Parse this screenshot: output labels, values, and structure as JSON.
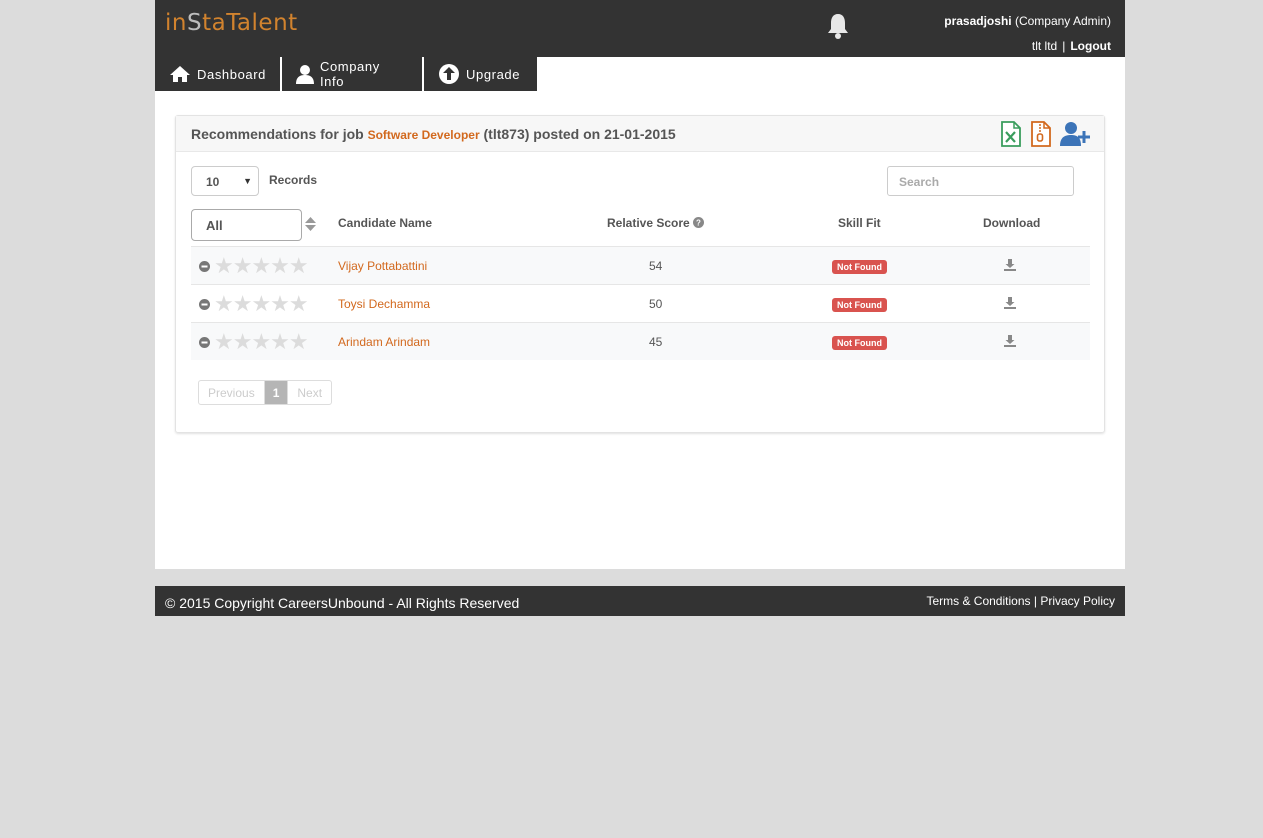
{
  "brand": {
    "logo_pre": "in",
    "logo_s": "S",
    "logo_post": "taTalent"
  },
  "user": {
    "name": "prasadjoshi",
    "role": "(Company Admin)",
    "org": "tlt ltd",
    "separator": "|",
    "logout": "Logout"
  },
  "nav": [
    {
      "label": "Dashboard",
      "icon": "home-icon"
    },
    {
      "label": "Company Info",
      "icon": "user-icon"
    },
    {
      "label": "Upgrade",
      "icon": "upload-circle-icon"
    }
  ],
  "panel": {
    "title_prefix": "Recommendations for job",
    "job_title": "Software Developer",
    "title_suffix": "(tlt873) posted on 21-01-2015",
    "icons": [
      "excel-export-icon",
      "zip-export-icon",
      "add-user-icon"
    ]
  },
  "controls": {
    "records_value": "10",
    "records_label": "Records",
    "search_placeholder": "Search",
    "filter_value": "All"
  },
  "table": {
    "headers": {
      "name": "Candidate Name",
      "score": "Relative Score",
      "skill": "Skill Fit",
      "download": "Download"
    },
    "rows": [
      {
        "name": "Vijay Pottabattini",
        "score": "54",
        "skill": "Not Found",
        "rating": 0
      },
      {
        "name": "Toysi Dechamma",
        "score": "50",
        "skill": "Not Found",
        "rating": 0
      },
      {
        "name": "Arindam Arindam",
        "score": "45",
        "skill": "Not Found",
        "rating": 0
      }
    ]
  },
  "pager": {
    "prev": "Previous",
    "current": "1",
    "next": "Next"
  },
  "footer": {
    "copyright": "© 2015 Copyright CareersUnbound - All Rights Reserved",
    "terms": "Terms & Conditions",
    "separator": "|",
    "privacy": "Privacy Policy"
  },
  "colors": {
    "accent": "#d2691e",
    "dark": "#333333",
    "danger": "#d9534f"
  }
}
